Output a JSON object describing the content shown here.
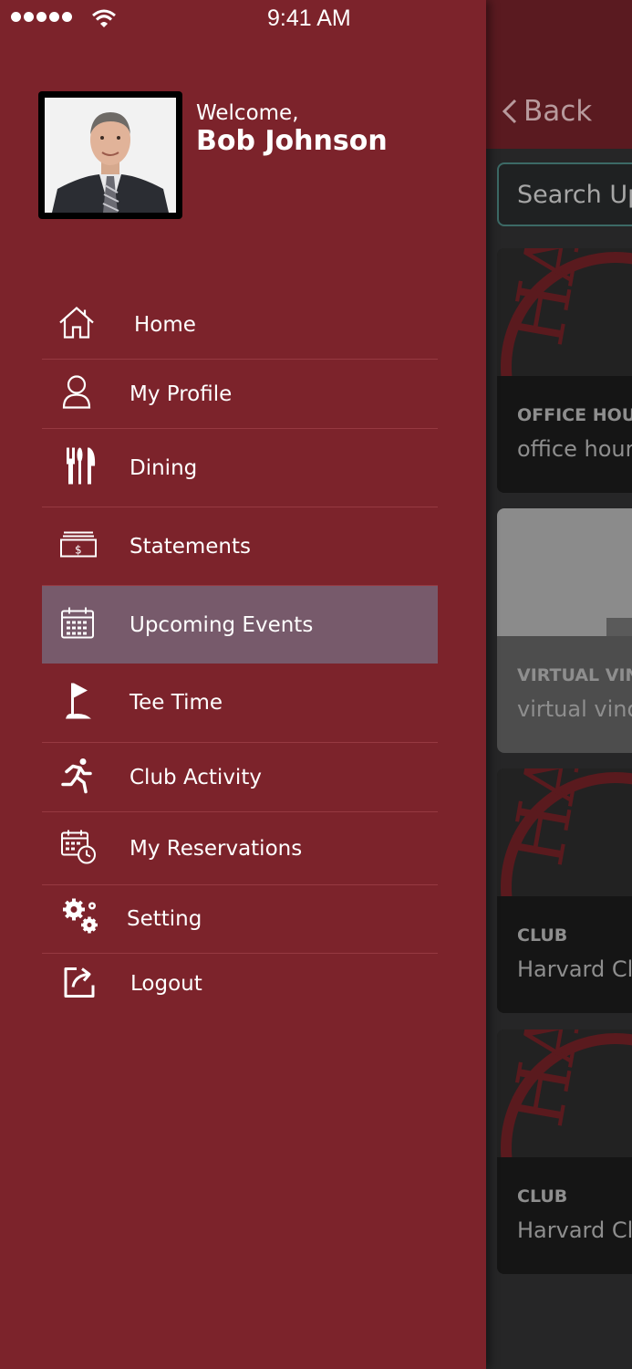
{
  "status_bar": {
    "time": "9:41 AM"
  },
  "profile": {
    "welcome": "Welcome,",
    "name": "Bob Johnson"
  },
  "menu": {
    "items": [
      {
        "label": "Home",
        "icon": "home-icon"
      },
      {
        "label": "My Profile",
        "icon": "user-icon"
      },
      {
        "label": "Dining",
        "icon": "fork-knife-icon"
      },
      {
        "label": "Statements",
        "icon": "statement-icon"
      },
      {
        "label": "Upcoming Events",
        "icon": "calendar-icon",
        "active": true
      },
      {
        "label": "Tee Time",
        "icon": "golf-flag-icon"
      },
      {
        "label": "Club Activity",
        "icon": "running-icon"
      },
      {
        "label": "My Reservations",
        "icon": "calendar-clock-icon"
      },
      {
        "label": "Setting",
        "icon": "gears-icon"
      },
      {
        "label": "Logout",
        "icon": "logout-icon"
      }
    ]
  },
  "background": {
    "back_label": "Back",
    "search_placeholder": "Search Up",
    "cards": [
      {
        "title": "OFFICE HOU",
        "subtitle": "office hour"
      },
      {
        "title": "VIRTUAL VIN",
        "subtitle": "virtual vino"
      },
      {
        "title": "CLUB",
        "subtitle": "Harvard Clu"
      },
      {
        "title": "CLUB",
        "subtitle": "Harvard Cl"
      }
    ]
  },
  "colors": {
    "drawer": "#7c232b",
    "active_item": "#775a6b",
    "header_bg": "#5a1a20"
  }
}
